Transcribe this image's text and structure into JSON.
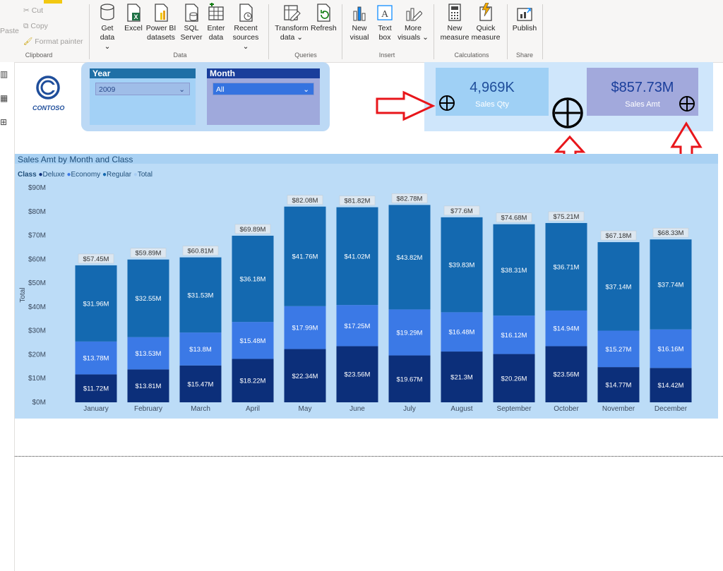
{
  "ribbon": {
    "clipboard": {
      "paste": "Paste",
      "cut": "Cut",
      "copy": "Copy",
      "format_painter": "Format painter",
      "group": "Clipboard"
    },
    "data": {
      "get_data": "Get",
      "get_data2": "data",
      "excel": "Excel",
      "powerbi1": "Power BI",
      "powerbi2": "datasets",
      "sql1": "SQL",
      "sql2": "Server",
      "enter1": "Enter",
      "enter2": "data",
      "recent1": "Recent",
      "recent2": "sources",
      "group": "Data"
    },
    "queries": {
      "transform1": "Transform",
      "transform2": "data",
      "refresh": "Refresh",
      "group": "Queries"
    },
    "insert": {
      "newvisual1": "New",
      "newvisual2": "visual",
      "textbox1": "Text",
      "textbox2": "box",
      "more1": "More",
      "more2": "visuals",
      "group": "Insert"
    },
    "calculations": {
      "newmeasure1": "New",
      "newmeasure2": "measure",
      "quick1": "Quick",
      "quick2": "measure",
      "group": "Calculations"
    },
    "share": {
      "publish": "Publish",
      "group": "Share"
    }
  },
  "logo_text": "CONTOSO",
  "slicers": {
    "year": {
      "title": "Year",
      "value": "2009"
    },
    "month": {
      "title": "Month",
      "value": "All"
    }
  },
  "cards": {
    "qty": {
      "value": "4,969K",
      "label": "Sales Qty"
    },
    "amt": {
      "value": "$857.73M",
      "label": "Sales Amt"
    }
  },
  "chart_data": {
    "type": "bar",
    "title": "Sales Amt by Month and Class",
    "legend_title": "Class",
    "legend": [
      "Deluxe",
      "Economy",
      "Regular",
      "Total"
    ],
    "ylabel": "Total",
    "ylim": [
      0,
      90
    ],
    "yticks": [
      "$0M",
      "$10M",
      "$20M",
      "$30M",
      "$40M",
      "$50M",
      "$60M",
      "$70M",
      "$80M",
      "$90M"
    ],
    "categories": [
      "January",
      "February",
      "March",
      "April",
      "May",
      "June",
      "July",
      "August",
      "September",
      "October",
      "November",
      "December"
    ],
    "series": [
      {
        "name": "Deluxe",
        "color": "#0c2f7a",
        "values": [
          11.72,
          13.81,
          15.47,
          18.22,
          22.34,
          23.56,
          19.67,
          21.3,
          20.26,
          23.56,
          14.77,
          14.42
        ],
        "labels": [
          "$11.72M",
          "$13.81M",
          "$15.47M",
          "$18.22M",
          "$22.34M",
          "$23.56M",
          "$19.67M",
          "$21.3M",
          "$20.26M",
          "$23.56M",
          "$14.77M",
          "$14.42M"
        ]
      },
      {
        "name": "Economy",
        "color": "#3b79e6",
        "values": [
          13.78,
          13.53,
          13.8,
          15.48,
          17.99,
          17.25,
          19.29,
          16.48,
          16.12,
          14.94,
          15.27,
          16.16
        ],
        "labels": [
          "$13.78M",
          "$13.53M",
          "$13.8M",
          "$15.48M",
          "$17.99M",
          "$17.25M",
          "$19.29M",
          "$16.48M",
          "$16.12M",
          "$14.94M",
          "$15.27M",
          "$16.16M"
        ]
      },
      {
        "name": "Regular",
        "color": "#1469b0",
        "values": [
          31.96,
          32.55,
          31.53,
          36.18,
          41.76,
          41.02,
          43.82,
          39.83,
          38.31,
          36.71,
          37.14,
          37.74
        ],
        "labels": [
          "$31.96M",
          "$32.55M",
          "$31.53M",
          "$36.18M",
          "$41.76M",
          "$41.02M",
          "$43.82M",
          "$39.83M",
          "$38.31M",
          "$36.71M",
          "$37.14M",
          "$37.74M"
        ]
      }
    ],
    "totals": {
      "values": [
        57.45,
        59.89,
        60.81,
        69.89,
        82.08,
        81.82,
        82.78,
        77.6,
        74.68,
        75.21,
        67.18,
        68.33
      ],
      "labels": [
        "$57.45M",
        "$59.89M",
        "$60.81M",
        "$69.89M",
        "$82.08M",
        "$81.82M",
        "$82.78M",
        "$77.6M",
        "$74.68M",
        "$75.21M",
        "$67.18M",
        "$68.33M"
      ]
    },
    "legend_colors": [
      "#0c2f7a",
      "#3b79e6",
      "#1469b0",
      "#a8cdf3"
    ]
  },
  "colors": {
    "card_qty_bg": "#9fd0f5",
    "card_amt_bg": "#a2a9dc",
    "card_group_bg": "#cfe6fb",
    "arrow_red": "#e8161b"
  }
}
